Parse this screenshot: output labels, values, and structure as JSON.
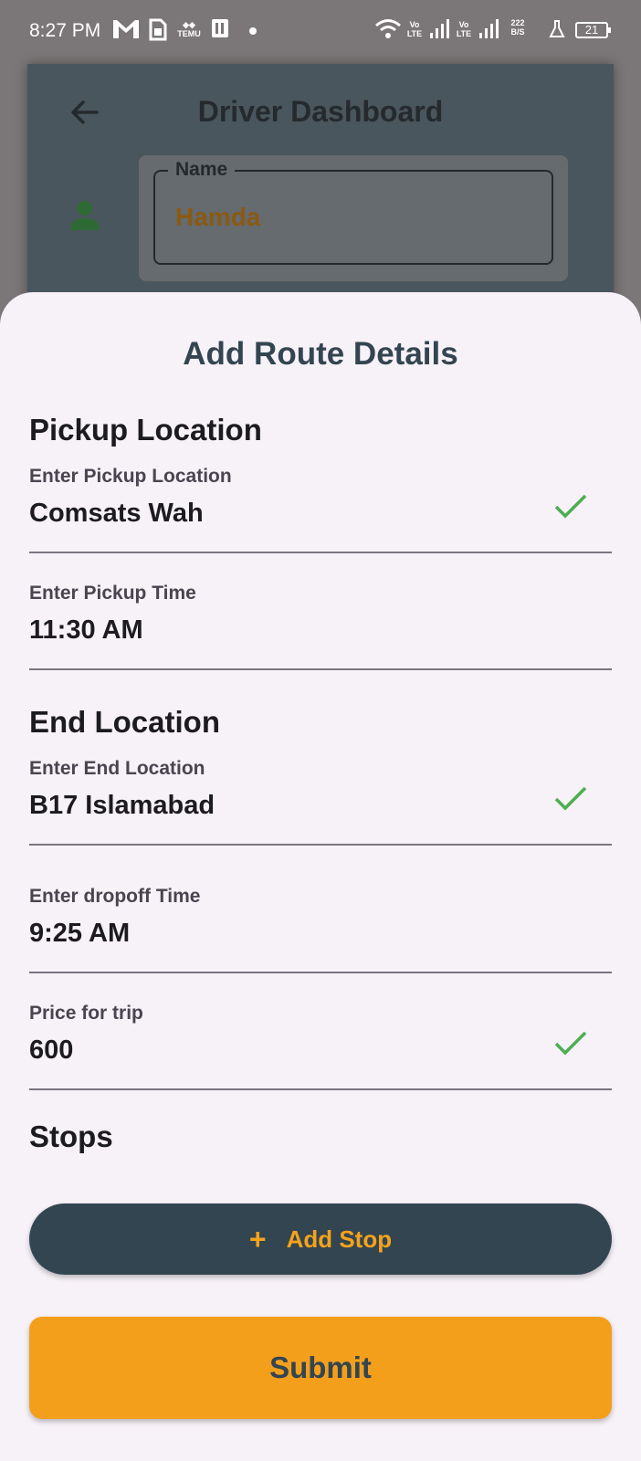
{
  "status_bar": {
    "time": "8:27 PM",
    "network_speed_value": "222",
    "network_speed_unit": "B/S",
    "vo_label": "Vo",
    "lte_label": "LTE",
    "temu_label": "TEMU",
    "battery": "21",
    "icons": [
      "gmail-icon",
      "sim-icon",
      "temu-icon",
      "app-icon",
      "dot-icon",
      "wifi-icon",
      "signal-icon",
      "signal-icon",
      "lab-icon",
      "battery-icon"
    ]
  },
  "background_app": {
    "title": "Driver Dashboard",
    "name_label": "Name",
    "name_value": "Hamda",
    "colors": {
      "person_icon": "#2e6b34",
      "name_value": "#8a5a12"
    }
  },
  "sheet": {
    "title": "Add Route Details",
    "pickup_heading": "Pickup Location",
    "pickup_location": {
      "label": "Enter Pickup Location",
      "value": "Comsats Wah",
      "valid": true
    },
    "pickup_time": {
      "label": "Enter Pickup Time",
      "value": "11:30 AM"
    },
    "end_heading": "End Location",
    "end_location": {
      "label": "Enter End Location",
      "value": "B17 Islamabad",
      "valid": true
    },
    "dropoff_time": {
      "label": "Enter dropoff Time",
      "value": "9:25 AM"
    },
    "price": {
      "label": "Price for trip",
      "value": "600",
      "valid": true
    },
    "stops_heading": "Stops",
    "add_stop_label": "Add Stop",
    "add_stop_icon": "+",
    "submit_label": "Submit"
  },
  "colors": {
    "primary_dark": "#334550",
    "accent_orange": "#f49f1c",
    "check_green": "#4caf50",
    "sheet_bg": "#f7f1f8"
  }
}
